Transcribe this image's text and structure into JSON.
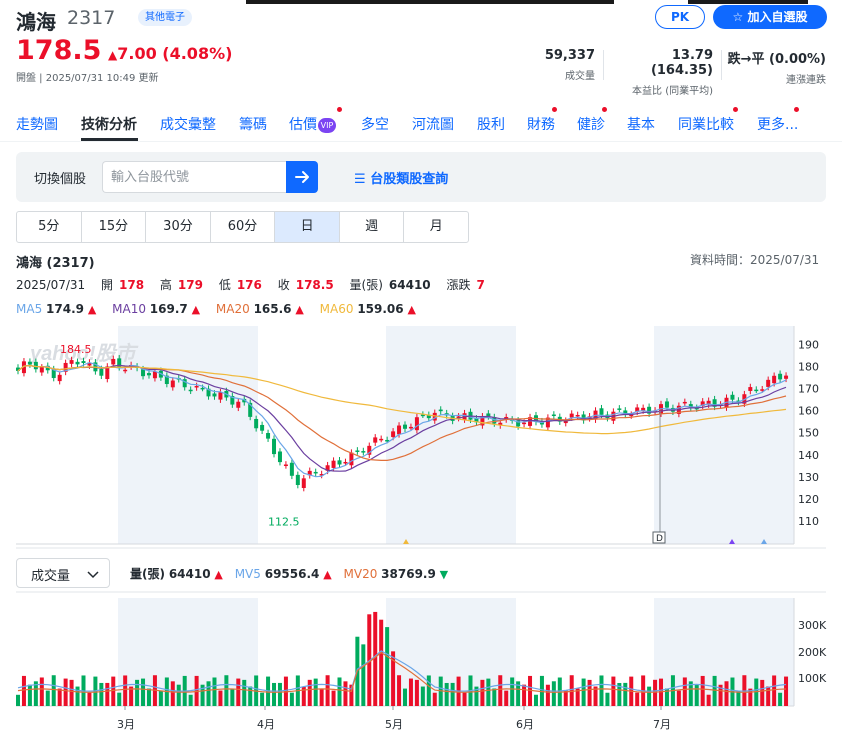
{
  "stock": {
    "name": "鴻海",
    "code": "2317",
    "category": "其他電子",
    "price": "178.5",
    "change": "7.00 (4.08%)",
    "status": "開盤 | 2025/07/31 10:49 更新"
  },
  "buttons": {
    "pk": "PK",
    "add_watchlist": "加入自選股"
  },
  "stats": [
    {
      "value": "59,337",
      "label": "成交量"
    },
    {
      "value": "13.79 (164.35)",
      "label": "本益比 (同業平均)"
    },
    {
      "value": "跌→平 (0.00%)",
      "label": "連漲連跌"
    }
  ],
  "tabs": [
    "走勢圖",
    "技術分析",
    "成交彙整",
    "籌碼",
    "估價",
    "多空",
    "河流圖",
    "股利",
    "財務",
    "健診",
    "基本",
    "同業比較",
    "更多..."
  ],
  "tab_vip": "VIP",
  "search": {
    "label": "切換個股",
    "placeholder": "輸入台股代號",
    "category_link": "台股類股查詢"
  },
  "periods": [
    "5分",
    "15分",
    "30分",
    "60分",
    "日",
    "週",
    "月"
  ],
  "chart_header": {
    "title": "鴻海 (2317)",
    "data_time": "資料時間：2025/07/31"
  },
  "ohlc": {
    "date": "2025/07/31",
    "open_label": "開",
    "open": "178",
    "high_label": "高",
    "high": "179",
    "low_label": "低",
    "low": "176",
    "close_label": "收",
    "close": "178.5",
    "vol_label": "量(張)",
    "vol": "64410",
    "chg_label": "漲跌",
    "chg": "7"
  },
  "ma": [
    {
      "label": "MA5",
      "value": "174.9",
      "color": "#6ba6e8"
    },
    {
      "label": "MA10",
      "value": "169.7",
      "color": "#6b3fa0"
    },
    {
      "label": "MA20",
      "value": "165.6",
      "color": "#e0703a"
    },
    {
      "label": "MA60",
      "value": "159.06",
      "color": "#f0b93c"
    }
  ],
  "volume_header": {
    "select": "成交量",
    "vol_label": "量(張)",
    "vol": "64410",
    "mv5_label": "MV5",
    "mv5": "69556.4",
    "mv20_label": "MV20",
    "mv20": "38769.9"
  },
  "watermark": "yahoo!股市",
  "chart_data": {
    "type": "candlestick",
    "y_ticks": [
      190,
      180,
      170,
      160,
      150,
      140,
      130,
      120,
      110
    ],
    "vol_ticks": [
      "300K",
      "200K",
      "100K"
    ],
    "x_ticks": [
      "3月",
      "4月",
      "5月",
      "6月",
      "7月"
    ],
    "annotations": {
      "high": "184.5",
      "low": "112.5",
      "marker": "D"
    },
    "colors": {
      "up": "#eb0f29",
      "down": "#00ab5e"
    }
  }
}
